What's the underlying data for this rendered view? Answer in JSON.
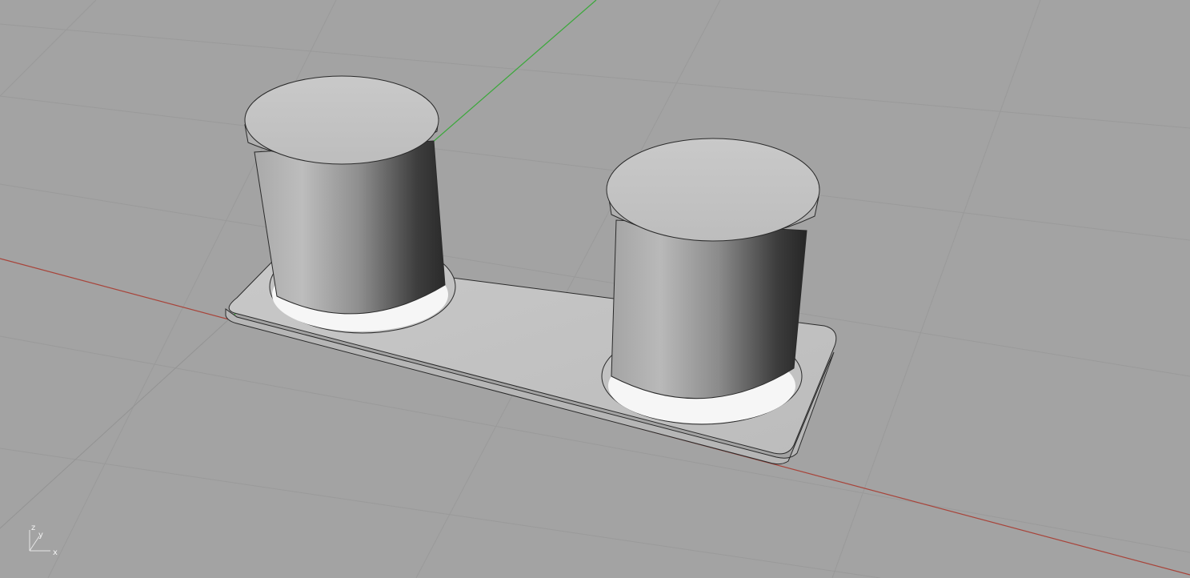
{
  "viewport": {
    "background_color": "#a3a3a3",
    "grid_color": "#9a9a9a",
    "x_axis_color": "#a8443a",
    "y_axis_color": "#3aa83a"
  },
  "axis_widget": {
    "z_label": "z",
    "y_label": "y",
    "x_label": "x"
  },
  "model": {
    "object_count": 3,
    "objects": [
      "base-plate",
      "bollard-left",
      "bollard-right"
    ],
    "shading_color": "#bfbfbf",
    "edge_color": "#2a2a2a"
  }
}
